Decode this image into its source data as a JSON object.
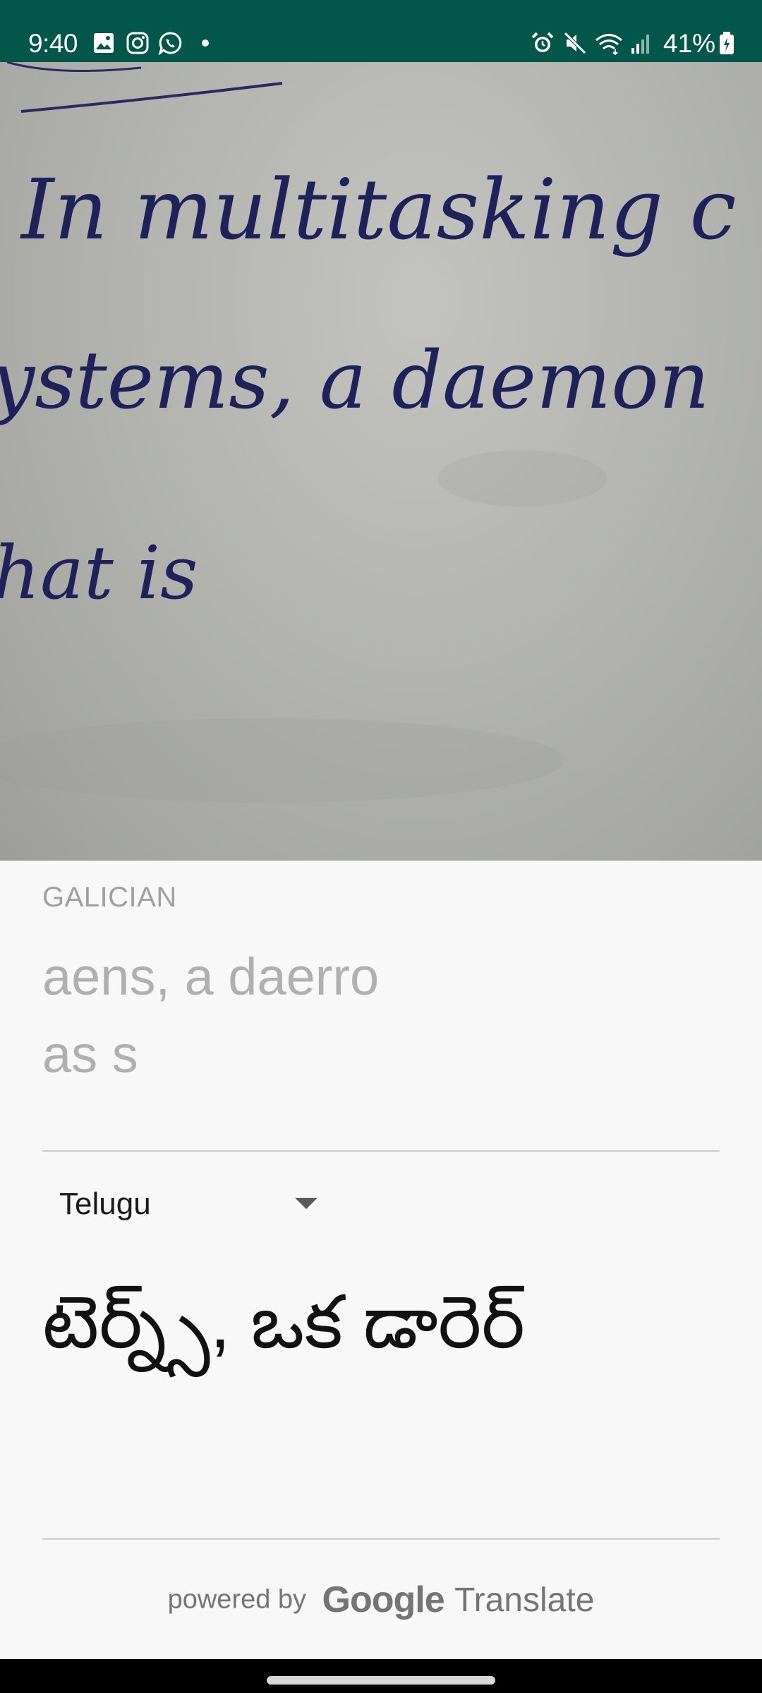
{
  "status_bar": {
    "time": "9:40",
    "left_icons": [
      "gallery-icon",
      "instagram-icon",
      "whatsapp-icon",
      "notification-dot"
    ],
    "right_icons": [
      "alarm-icon",
      "mute-icon",
      "wifi-icon",
      "signal-icon",
      "battery-icon"
    ],
    "battery": "41%",
    "background": "#02564a"
  },
  "camera": {
    "handwritten_lines": [
      "In multitasking c",
      "ystems, a daemon",
      "hat is"
    ]
  },
  "translation": {
    "source_language": "GALICIAN",
    "source_lines": [
      "aens, a daerro",
      "as s"
    ],
    "target_language": "Telugu",
    "target_text": "టెర్న్స్, ఒక డారెర్"
  },
  "footer": {
    "powered_by": "powered by",
    "brand_google": "Google",
    "brand_translate": "Translate"
  }
}
